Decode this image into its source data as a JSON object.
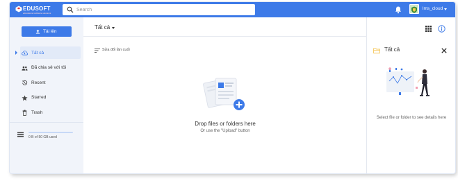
{
  "app": {
    "brand_name": "EDUSOFT",
    "brand_tagline": "educational software solutions"
  },
  "search": {
    "placeholder": "Search"
  },
  "user": {
    "name": "lms_cloud"
  },
  "sidebar": {
    "upload_label": "Tải lên",
    "items": [
      {
        "label": "Tất cả",
        "icon": "cloud-upload-icon",
        "active": true
      },
      {
        "label": "Đã chia sẻ với tôi",
        "icon": "people-icon",
        "active": false
      },
      {
        "label": "Recent",
        "icon": "history-icon",
        "active": false
      },
      {
        "label": "Starred",
        "icon": "star-icon",
        "active": false
      },
      {
        "label": "Trash",
        "icon": "trash-icon",
        "active": false
      }
    ],
    "storage": {
      "text": "0 B of 50 GB used",
      "used_fraction": 0
    }
  },
  "main": {
    "folder_title": "Tất cả",
    "sort_label": "Sửa đổi lần cuối",
    "empty_title": "Drop files or folders here",
    "empty_subtitle": "Or use the \"Upload\" button"
  },
  "details": {
    "title": "Tất cả",
    "message": "Select file or folder to see details here"
  },
  "colors": {
    "accent": "#3d7ae8",
    "sidebar_bg": "#f1f4fa",
    "active_item_bg": "#e2eaf8",
    "folder_yellow": "#f6c85f"
  }
}
